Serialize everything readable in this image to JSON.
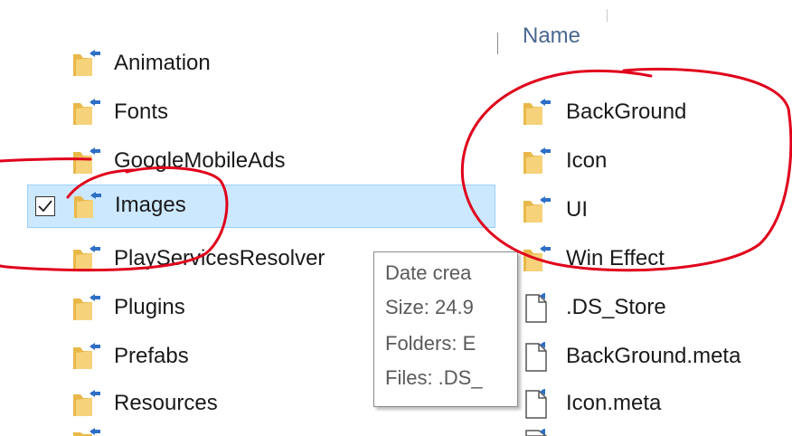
{
  "nav": {
    "items": [
      {
        "label": "Animation"
      },
      {
        "label": "Fonts"
      },
      {
        "label": "GoogleMobileAds"
      },
      {
        "label": "Images",
        "selected": true
      },
      {
        "label": "PlayServicesResolver"
      },
      {
        "label": "Plugins"
      },
      {
        "label": "Prefabs"
      },
      {
        "label": "Resources"
      }
    ]
  },
  "tooltip": {
    "date": "Date crea",
    "size": "Size: 24.9",
    "folders": "Folders: E",
    "files": "Files: .DS_"
  },
  "content": {
    "column_header": "Name",
    "items": [
      {
        "label": "BackGround",
        "type": "folder"
      },
      {
        "label": "Icon",
        "type": "folder"
      },
      {
        "label": "UI",
        "type": "folder"
      },
      {
        "label": "Win Effect",
        "type": "folder"
      },
      {
        "label": ".DS_Store",
        "type": "file"
      },
      {
        "label": "BackGround.meta",
        "type": "file"
      },
      {
        "label": "Icon.meta",
        "type": "file"
      }
    ]
  },
  "colors": {
    "selection_bg": "#cce8ff",
    "selection_border": "#99d1ff",
    "annotation_red": "#e0001b",
    "folder_yellow": "#e8b84a",
    "folder_pin_blue": "#2f6fc6"
  },
  "icons": {
    "nav_folder": "pinned-folder-icon",
    "content_folder": "pinned-folder-icon",
    "content_file": "file-icon",
    "checkbox": "checkbox-checked-icon"
  }
}
